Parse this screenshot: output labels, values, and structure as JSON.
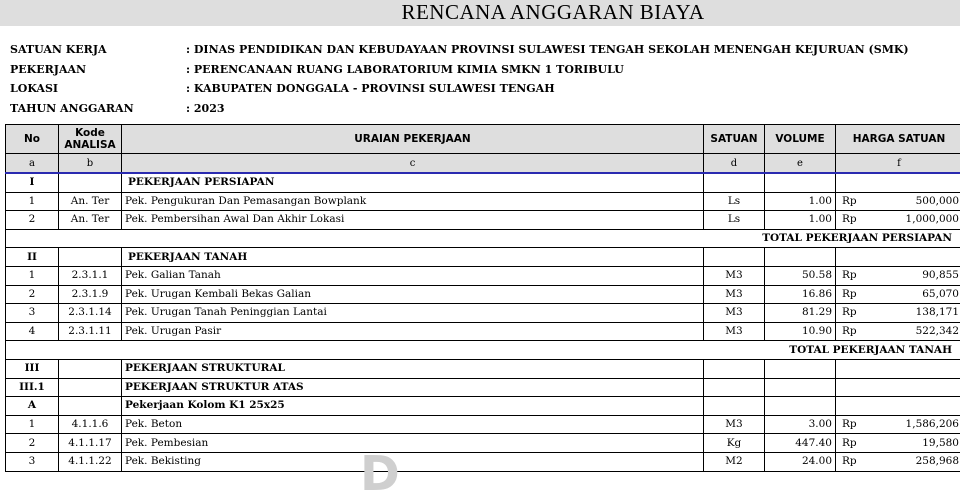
{
  "title": "RENCANA ANGGARAN BIAYA",
  "info": [
    {
      "label": "SATUAN KERJA",
      "value": ": DINAS PENDIDIKAN DAN KEBUDAYAAN PROVINSI SULAWESI TENGAH SEKOLAH MENENGAH KEJURUAN (SMK)"
    },
    {
      "label": "PEKERJAAN",
      "value": ": PERENCANAAN RUANG LABORATORIUM KIMIA SMKN 1 TORIBULU"
    },
    {
      "label": "LOKASI",
      "value": ": KABUPATEN DONGGALA - PROVINSI SULAWESI TENGAH"
    },
    {
      "label": "TAHUN ANGGARAN",
      "value": ": 2023"
    }
  ],
  "headers": {
    "no": "No",
    "kode1": "Kode",
    "kode2": "ANALISA",
    "uraian": "URAIAN PEKERJAAN",
    "satuan": "SATUAN",
    "volume": "VOLUME",
    "harga": "HARGA SATUAN"
  },
  "letters": [
    "a",
    "b",
    "c",
    "d",
    "e",
    "f"
  ],
  "rows": [
    {
      "type": "section",
      "no": "I",
      "desc": "PEKERJAAN PERSIAPAN"
    },
    {
      "type": "item",
      "no": "1",
      "kode": "An. Ter",
      "desc": "Pek. Pengukuran Dan Pemasangan Bowplank",
      "satuan": "Ls",
      "volume": "1.00",
      "rp": "Rp",
      "harga": "500,000"
    },
    {
      "type": "item",
      "no": "2",
      "kode": "An. Ter",
      "desc": "Pek. Pembersihan Awal Dan Akhir Lokasi",
      "satuan": "Ls",
      "volume": "1.00",
      "rp": "Rp",
      "harga": "1,000,000"
    },
    {
      "type": "total",
      "label": "TOTAL PEKERJAAN PERSIAPAN"
    },
    {
      "type": "section",
      "no": "II",
      "desc": "PEKERJAAN TANAH"
    },
    {
      "type": "item",
      "no": "1",
      "kode": "2.3.1.1",
      "desc": "Pek. Galian Tanah",
      "satuan": "M3",
      "volume": "50.58",
      "rp": "Rp",
      "harga": "90,855"
    },
    {
      "type": "item",
      "no": "2",
      "kode": "2.3.1.9",
      "desc": "Pek. Urugan Kembali Bekas Galian",
      "satuan": "M3",
      "volume": "16.86",
      "rp": "Rp",
      "harga": "65,070"
    },
    {
      "type": "item",
      "no": "3",
      "kode": "2.3.1.14",
      "desc": "Pek. Urugan Tanah Peninggian Lantai",
      "satuan": "M3",
      "volume": "81.29",
      "rp": "Rp",
      "harga": "138,171"
    },
    {
      "type": "item",
      "no": "4",
      "kode": "2.3.1.11",
      "desc": "Pek. Urugan Pasir",
      "satuan": "M3",
      "volume": "10.90",
      "rp": "Rp",
      "harga": "522,342"
    },
    {
      "type": "total",
      "label": "TOTAL PEKERJAAN TANAH"
    },
    {
      "type": "section",
      "no": "III",
      "desc": "PEKERJAAN STRUKTURAL"
    },
    {
      "type": "section",
      "no": "III.1",
      "desc": "PEKERJAAN STRUKTUR ATAS"
    },
    {
      "type": "section",
      "no": "A",
      "desc": "Pekerjaan Kolom K1 25x25"
    },
    {
      "type": "item",
      "no": "1",
      "kode": "4.1.1.6",
      "desc": "Pek. Beton",
      "satuan": "M3",
      "volume": "3.00",
      "rp": "Rp",
      "harga": "1,586,206"
    },
    {
      "type": "item",
      "no": "2",
      "kode": "4.1.1.17",
      "desc": "Pek. Pembesian",
      "satuan": "Kg",
      "volume": "447.40",
      "rp": "Rp",
      "harga": "19,580"
    },
    {
      "type": "item",
      "no": "3",
      "kode": "4.1.1.22",
      "desc": "Pek. Bekisting",
      "satuan": "M2",
      "volume": "24.00",
      "rp": "Rp",
      "harga": "258,968"
    }
  ],
  "colors": {
    "header_bg": "#dedede",
    "separator": "#2a2ab0"
  }
}
